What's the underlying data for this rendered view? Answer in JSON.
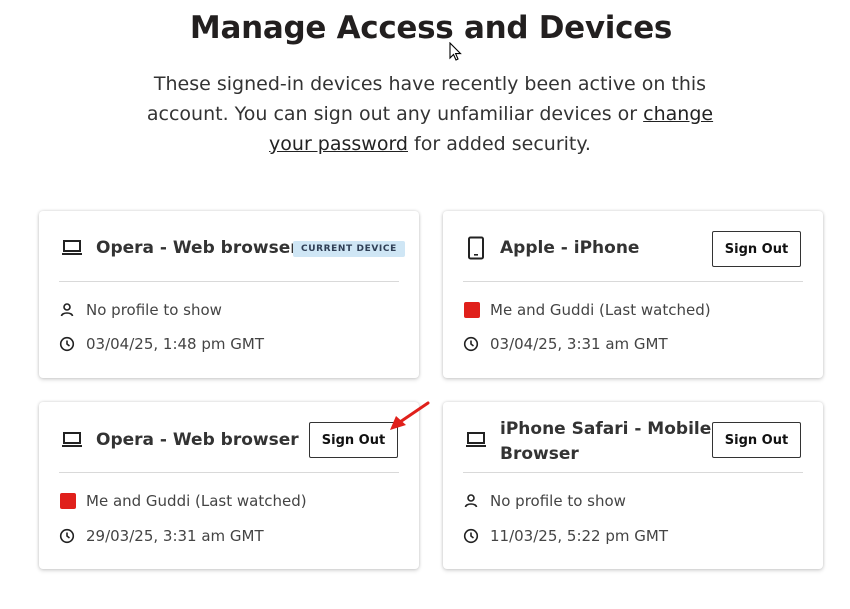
{
  "page": {
    "title": "Manage Access and Devices",
    "intro_before": "These signed-in devices have recently been active on this account. You can sign out any unfamiliar devices or ",
    "intro_link": "change your password",
    "intro_after": " for added security."
  },
  "devices": [
    {
      "name": "Opera - Web browser",
      "icon": "laptop-icon",
      "badge": "CURRENT DEVICE",
      "profile": "No profile to show",
      "profile_icon": "person-icon",
      "time": "03/04/25, 1:48 pm GMT"
    },
    {
      "name": "Apple - iPhone",
      "icon": "phone-icon",
      "button": "Sign Out",
      "profile": "Me and Guddi (Last watched)",
      "profile_icon": "profile-avatar",
      "time": "03/04/25, 3:31 am GMT"
    },
    {
      "name": "Opera - Web browser",
      "icon": "laptop-icon",
      "button": "Sign Out",
      "profile": "Me and Guddi (Last watched)",
      "profile_icon": "profile-avatar",
      "time": "29/03/25, 3:31 am GMT"
    },
    {
      "name_line1": "iPhone Safari - Mobile",
      "name_line2": "Browser",
      "icon": "laptop-icon",
      "button": "Sign Out",
      "profile": "No profile to show",
      "profile_icon": "person-icon",
      "time": "11/03/25, 5:22 pm GMT"
    }
  ],
  "colors": {
    "badge_bg": "#cfe6f5",
    "avatar": "#e0201b",
    "annotation_arrow": "#e0201b"
  }
}
